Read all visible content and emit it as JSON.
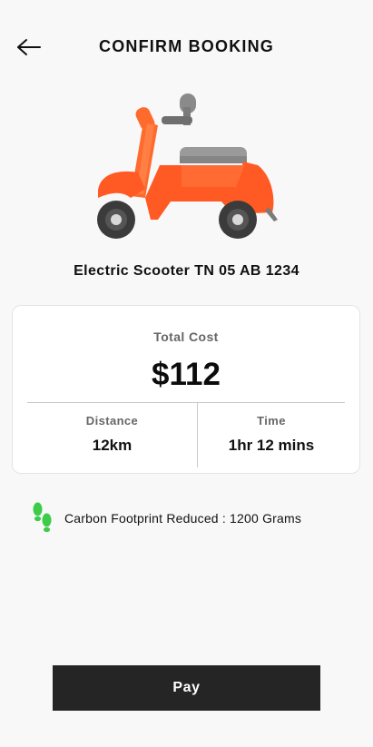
{
  "header": {
    "title": "CONFIRM BOOKING",
    "back_icon": "arrow-left-icon"
  },
  "vehicle": {
    "image_icon": "scooter-illustration",
    "name": "Electric Scooter TN 05 AB 1234",
    "body_color": "#FF5A24"
  },
  "cost_card": {
    "total_label": "Total Cost",
    "total_value": "$112",
    "distance_label": "Distance",
    "distance_value": "12km",
    "time_label": "Time",
    "time_value": "1hr 12 mins"
  },
  "carbon": {
    "icon": "footprints-icon",
    "text": "Carbon Footprint Reduced :  1200 Grams",
    "icon_color": "#3DCB4A"
  },
  "actions": {
    "pay_label": "Pay"
  }
}
